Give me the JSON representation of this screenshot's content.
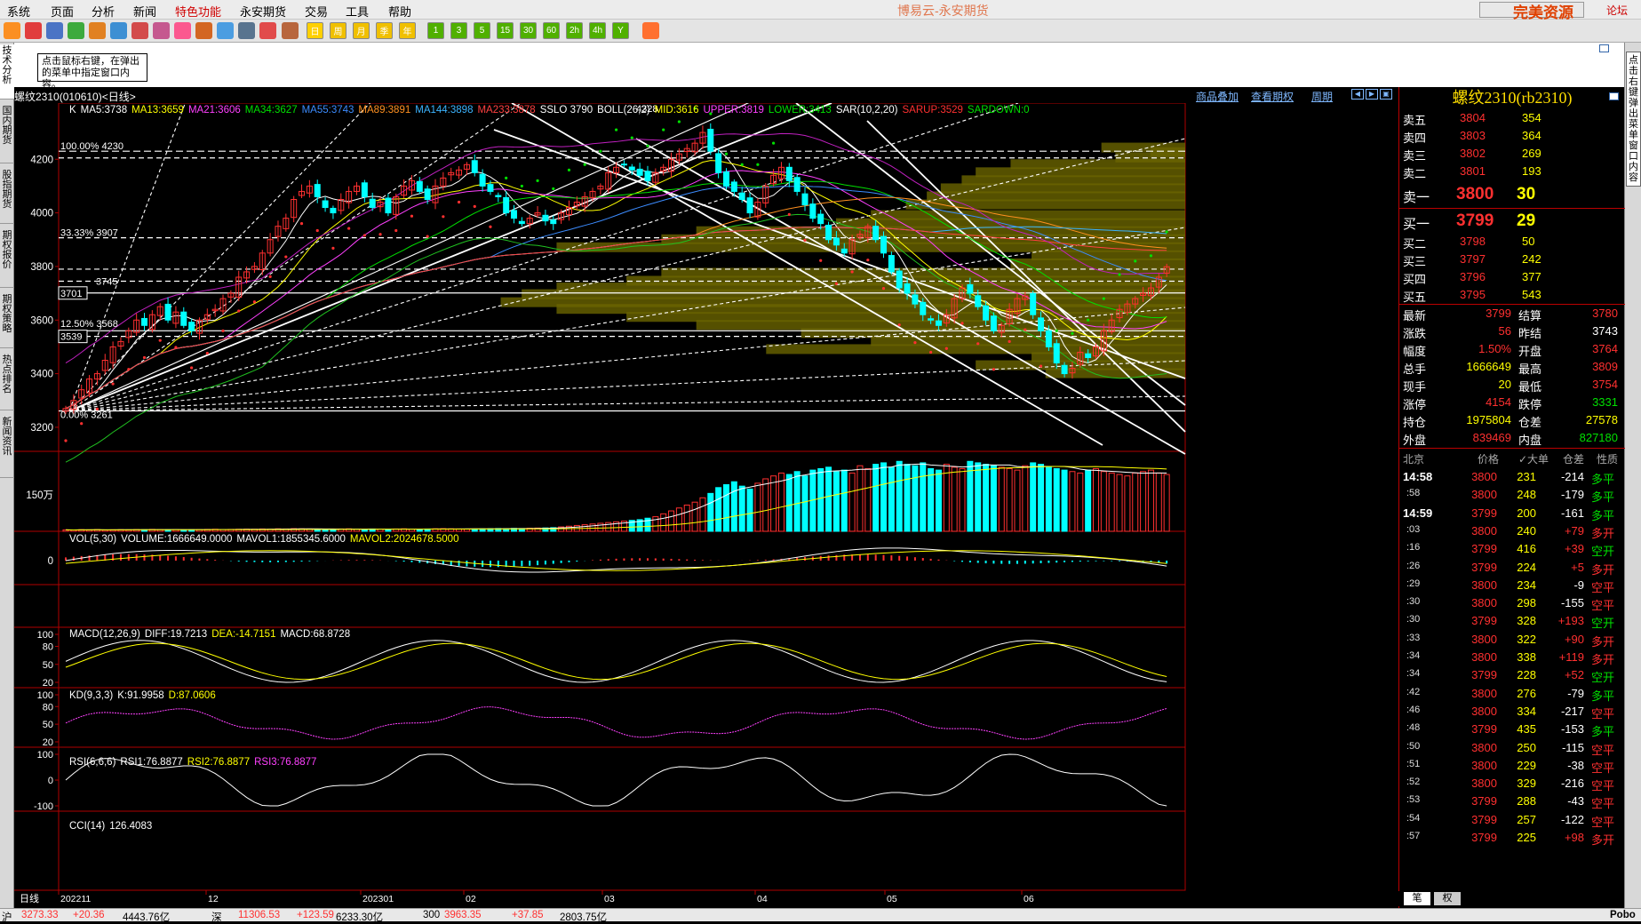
{
  "app": {
    "title": "博易云-永安期货"
  },
  "menu": [
    "系统",
    "页面",
    "分析",
    "新闻",
    "特色功能",
    "永安期货",
    "交易",
    "工具",
    "帮助"
  ],
  "window_controls": [
    "论坛",
    "—",
    "□",
    "×"
  ],
  "watermark": "完美资源 5etz.com",
  "toolbar_icons": [
    "back-icon",
    "home-icon",
    "quote-icon",
    "realtime-icon",
    "search-icon",
    "indicator-icon",
    "grid-icon",
    "pen-icon",
    "brush-icon",
    "cut-icon",
    "branch-icon",
    "table-icon",
    "kline-icon",
    "f10-icon",
    "day-icon",
    "week-icon",
    "month-icon",
    "quarter-icon",
    "year-icon",
    "m1-icon",
    "m3-icon",
    "m5-icon",
    "m15-icon",
    "m30-icon",
    "m60-icon",
    "m2h-icon",
    "m4h-icon",
    "y-icon",
    "calc-icon"
  ],
  "toolbar_labels": [
    "日",
    "周",
    "月",
    "季",
    "年",
    "1",
    "3",
    "5",
    "15",
    "30",
    "60",
    "2h",
    "4h",
    "Y"
  ],
  "left_tabs": [
    "技术分析",
    "国内期货",
    "股指期货",
    "期权报价",
    "期权策略",
    "热点排名",
    "新闻资讯"
  ],
  "right_tab": "点击右键弹出菜单窗口内容",
  "note": "点击鼠标右键，在弹出的菜单中指定窗口内容。",
  "chart_header": {
    "symbol": "螺纹2310(010610)<日线>",
    "links": [
      "商品叠加",
      "查看期权",
      "周期"
    ]
  },
  "legend_main": [
    {
      "t": "K",
      "c": "#ffffff"
    },
    {
      "t": "MA5:3738",
      "c": "#ffffff"
    },
    {
      "t": "MA13:3659",
      "c": "#ffff00"
    },
    {
      "t": "MA21:3606",
      "c": "#ff40ff"
    },
    {
      "t": "MA34:3627",
      "c": "#00e000"
    },
    {
      "t": "MA55:3743",
      "c": "#3c8cff"
    },
    {
      "t": "MA89:3891",
      "c": "#ff9020"
    },
    {
      "t": "MA144:3898",
      "c": "#3cb4ff"
    },
    {
      "t": "MA233:3878",
      "c": "#ff4040"
    },
    {
      "t": "SSLO 3790",
      "c": "#ffffff"
    },
    {
      "t": "BOLL(26,2)",
      "c": "#ffffff"
    },
    {
      "t": "MID:3616",
      "c": "#ffff00"
    },
    {
      "t": "UPPER:3819",
      "c": "#ff40ff"
    },
    {
      "t": "LOWER:3413",
      "c": "#00e000"
    },
    {
      "t": "SAR(10,2,20)",
      "c": "#ffffff"
    },
    {
      "t": "SARUP:3529",
      "c": "#ff3030"
    },
    {
      "t": "SARDOWN:0",
      "c": "#00e000"
    }
  ],
  "legend_vol": [
    {
      "t": "VOL(5,30)",
      "c": "#ffffff"
    },
    {
      "t": "VOLUME:1666649.0000",
      "c": "#ffffff"
    },
    {
      "t": "MAVOL1:1855345.6000",
      "c": "#ffffff"
    },
    {
      "t": "MAVOL2:2024678.5000",
      "c": "#ffff00"
    }
  ],
  "legend_macd": [
    {
      "t": "MACD(12,26,9)",
      "c": "#ffffff"
    },
    {
      "t": "DIFF:19.7213",
      "c": "#ffffff"
    },
    {
      "t": "DEA:-14.7151",
      "c": "#ffff00"
    },
    {
      "t": "MACD:68.8728",
      "c": "#ffffff"
    }
  ],
  "legend_kd": [
    {
      "t": "KD(9,3,3)",
      "c": "#ffffff"
    },
    {
      "t": "K:91.9958",
      "c": "#ffffff"
    },
    {
      "t": "D:87.0606",
      "c": "#ffff00"
    }
  ],
  "legend_rsi": [
    {
      "t": "RSI(6,6,6)",
      "c": "#ffffff"
    },
    {
      "t": "RSI1:76.8877",
      "c": "#ffffff"
    },
    {
      "t": "RSI2:76.8877",
      "c": "#ffff00"
    },
    {
      "t": "RSI3:76.8877",
      "c": "#ff40ff"
    }
  ],
  "legend_cci": [
    {
      "t": "CCI(14)",
      "c": "#ffffff"
    },
    {
      "t": "126.4083",
      "c": "#ffffff"
    }
  ],
  "axis": {
    "price_ticks": [
      "4200",
      "4000",
      "3800",
      "3600",
      "3400",
      "3200"
    ],
    "vol_tick": "150万",
    "macd_tick": "0",
    "kd_ticks": [
      "100",
      "80",
      "50",
      "20"
    ],
    "rsi_ticks": [
      "100",
      "80",
      "50",
      "20"
    ],
    "cci_ticks": [
      "100",
      "0",
      "-100"
    ],
    "x_label_prefix": "日线",
    "x_ticks": [
      "202211",
      "12",
      "202301",
      "02",
      "03",
      "04",
      "05",
      "06"
    ]
  },
  "annotations": {
    "high_label": "4328",
    "fib_100": "100.00%  4230",
    "fib_3333": "33.33%  3907",
    "fib_1250": "12.50%  3568",
    "fib_0": "0.00%  3261",
    "box_3701": "3701",
    "fib_3745": "3745",
    "box_3539": "3539"
  },
  "quote": {
    "title": "螺纹2310(rb2310)",
    "asks": [
      {
        "label": "卖五",
        "price": "3804",
        "vol": "354"
      },
      {
        "label": "卖四",
        "price": "3803",
        "vol": "364"
      },
      {
        "label": "卖三",
        "price": "3802",
        "vol": "269"
      },
      {
        "label": "卖二",
        "price": "3801",
        "vol": "193"
      }
    ],
    "ask1": {
      "label": "卖一",
      "price": "3800",
      "vol": "30"
    },
    "bid1": {
      "label": "买一",
      "price": "3799",
      "vol": "29"
    },
    "bids": [
      {
        "label": "买二",
        "price": "3798",
        "vol": "50"
      },
      {
        "label": "买三",
        "price": "3797",
        "vol": "242"
      },
      {
        "label": "买四",
        "price": "3796",
        "vol": "377"
      },
      {
        "label": "买五",
        "price": "3795",
        "vol": "543"
      }
    ],
    "stats": [
      {
        "l1": "最新",
        "v1": "3799",
        "c1": "#ff3030",
        "l2": "结算",
        "v2": "3780",
        "c2": "#ff3030"
      },
      {
        "l1": "涨跌",
        "v1": "56",
        "c1": "#ff3030",
        "l2": "昨结",
        "v2": "3743",
        "c2": "#ffffff"
      },
      {
        "l1": "幅度",
        "v1": "1.50%",
        "c1": "#ff3030",
        "l2": "开盘",
        "v2": "3764",
        "c2": "#ff3030"
      },
      {
        "l1": "总手",
        "v1": "1666649",
        "c1": "#ffff00",
        "l2": "最高",
        "v2": "3809",
        "c2": "#ff3030"
      },
      {
        "l1": "现手",
        "v1": "20",
        "c1": "#ffff00",
        "l2": "最低",
        "v2": "3754",
        "c2": "#ff3030"
      },
      {
        "l1": "涨停",
        "v1": "4154",
        "c1": "#ff3030",
        "l2": "跌停",
        "v2": "3331",
        "c2": "#00e000"
      },
      {
        "l1": "持仓",
        "v1": "1975804",
        "c1": "#ffff00",
        "l2": "仓差",
        "v2": "27578",
        "c2": "#ffff00"
      },
      {
        "l1": "外盘",
        "v1": "839469",
        "c1": "#ff3030",
        "l2": "内盘",
        "v2": "827180",
        "c2": "#00e000"
      }
    ],
    "tick_header": [
      "北京",
      "价格",
      "✓大单",
      "仓差",
      "性质"
    ],
    "ticks": [
      {
        "t": "14:58",
        "p": "3800",
        "pc": "#ff3030",
        "v": "231",
        "d": "-214",
        "n": "多平",
        "nc": "#00e000"
      },
      {
        "t": ":58",
        "p": "3800",
        "pc": "#ff3030",
        "v": "248",
        "d": "-179",
        "n": "多平",
        "nc": "#00e000"
      },
      {
        "t": "14:59",
        "p": "3799",
        "pc": "#ff3030",
        "v": "200",
        "d": "-161",
        "n": "多平",
        "nc": "#00e000"
      },
      {
        "t": ":03",
        "p": "3800",
        "pc": "#ff3030",
        "v": "240",
        "d": "+79",
        "n": "多开",
        "nc": "#ff3030"
      },
      {
        "t": ":16",
        "p": "3799",
        "pc": "#ff3030",
        "v": "416",
        "d": "+39",
        "n": "空开",
        "nc": "#00e000"
      },
      {
        "t": ":26",
        "p": "3799",
        "pc": "#ff3030",
        "v": "224",
        "d": "+5",
        "n": "多开",
        "nc": "#ff3030"
      },
      {
        "t": ":29",
        "p": "3800",
        "pc": "#ff3030",
        "v": "234",
        "d": "-9",
        "n": "空平",
        "nc": "#ff3030"
      },
      {
        "t": ":30",
        "p": "3800",
        "pc": "#ff3030",
        "v": "298",
        "d": "-155",
        "n": "空平",
        "nc": "#ff3030"
      },
      {
        "t": ":30",
        "p": "3799",
        "pc": "#ff3030",
        "v": "328",
        "d": "+193",
        "n": "空开",
        "nc": "#00e000"
      },
      {
        "t": ":33",
        "p": "3800",
        "pc": "#ff3030",
        "v": "322",
        "d": "+90",
        "n": "多开",
        "nc": "#ff3030"
      },
      {
        "t": ":34",
        "p": "3800",
        "pc": "#ff3030",
        "v": "338",
        "d": "+119",
        "n": "多开",
        "nc": "#ff3030"
      },
      {
        "t": ":34",
        "p": "3799",
        "pc": "#ff3030",
        "v": "228",
        "d": "+52",
        "n": "空开",
        "nc": "#00e000"
      },
      {
        "t": ":42",
        "p": "3800",
        "pc": "#ff3030",
        "v": "276",
        "d": "-79",
        "n": "多平",
        "nc": "#00e000"
      },
      {
        "t": ":46",
        "p": "3800",
        "pc": "#ff3030",
        "v": "334",
        "d": "-217",
        "n": "空平",
        "nc": "#ff3030"
      },
      {
        "t": ":48",
        "p": "3799",
        "pc": "#ff3030",
        "v": "435",
        "d": "-153",
        "n": "多平",
        "nc": "#00e000"
      },
      {
        "t": ":50",
        "p": "3800",
        "pc": "#ff3030",
        "v": "250",
        "d": "-115",
        "n": "空平",
        "nc": "#ff3030"
      },
      {
        "t": ":51",
        "p": "3800",
        "pc": "#ff3030",
        "v": "229",
        "d": "-38",
        "n": "空平",
        "nc": "#ff3030"
      },
      {
        "t": ":52",
        "p": "3800",
        "pc": "#ff3030",
        "v": "329",
        "d": "-216",
        "n": "空平",
        "nc": "#ff3030"
      },
      {
        "t": ":53",
        "p": "3799",
        "pc": "#ff3030",
        "v": "288",
        "d": "-43",
        "n": "空平",
        "nc": "#ff3030"
      },
      {
        "t": ":54",
        "p": "3799",
        "pc": "#ff3030",
        "v": "257",
        "d": "-122",
        "n": "空平",
        "nc": "#ff3030"
      },
      {
        "t": ":57",
        "p": "3799",
        "pc": "#ff3030",
        "v": "225",
        "d": "+98",
        "n": "多开",
        "nc": "#ff3030"
      }
    ],
    "bottom_tabs": [
      "笔",
      "权"
    ]
  },
  "status_bar": [
    {
      "label": "沪",
      "value": "3273.33",
      "vc": "#ff3030",
      "chg": "+20.36",
      "cc": "#ff3030",
      "amt": "4443.76亿"
    },
    {
      "label": "深",
      "value": "11306.53",
      "vc": "#ff3030",
      "chg": "+123.59",
      "cc": "#ff3030",
      "amt": "6233.30亿"
    },
    {
      "label": "300",
      "value": "3963.35",
      "vc": "#ff3030",
      "chg": "+37.85",
      "cc": "#ff3030",
      "amt": "2803.75亿"
    }
  ],
  "status_right": "Pobo",
  "chart_data": {
    "type": "candlestick",
    "title": "螺纹2310(010610)<日线>",
    "ylim": [
      3150,
      4350
    ],
    "price_ticks": [
      3200,
      3400,
      3600,
      3800,
      4000,
      4200
    ],
    "x_ticks": [
      "202211",
      "12",
      "202301",
      "02",
      "03",
      "04",
      "05",
      "06"
    ],
    "close_path": [
      3270,
      3300,
      3340,
      3380,
      3400,
      3450,
      3500,
      3520,
      3560,
      3600,
      3580,
      3620,
      3650,
      3600,
      3630,
      3580,
      3560,
      3600,
      3620,
      3640,
      3680,
      3700,
      3760,
      3780,
      3800,
      3850,
      3900,
      3950,
      3980,
      4050,
      4080,
      4100,
      4060,
      4020,
      4000,
      4050,
      4080,
      4100,
      4060,
      4020,
      4040,
      4000,
      4060,
      4100,
      4120,
      4080,
      4050,
      4100,
      4130,
      4150,
      4160,
      4180,
      4150,
      4100,
      4080,
      4060,
      4000,
      3980,
      3960,
      3980,
      4000,
      3970,
      3960,
      4000,
      4020,
      4040,
      4060,
      4080,
      4100,
      4150,
      4170,
      4180,
      4160,
      4140,
      4120,
      4150,
      4170,
      4200,
      4220,
      4240,
      4260,
      4300,
      4230,
      4150,
      4100,
      4080,
      4050,
      4000,
      4040,
      4100,
      4140,
      4170,
      4120,
      4080,
      4030,
      3980,
      3960,
      3900,
      3880,
      3850,
      3900,
      3920,
      3950,
      3900,
      3850,
      3780,
      3720,
      3700,
      3660,
      3620,
      3600,
      3580,
      3620,
      3680,
      3720,
      3700,
      3650,
      3600,
      3560,
      3580,
      3640,
      3680,
      3690,
      3620,
      3560,
      3500,
      3440,
      3400,
      3420,
      3480,
      3460,
      3500,
      3560,
      3600,
      3640,
      3660,
      3680,
      3700,
      3720,
      3760,
      3799
    ],
    "vol_path": [
      10,
      9,
      11,
      10,
      12,
      9,
      10,
      11,
      10,
      12,
      11,
      13,
      12,
      11,
      12,
      10,
      11,
      12,
      13,
      14,
      12,
      13,
      14,
      15,
      14,
      16,
      15,
      17,
      16,
      18,
      17,
      16,
      15,
      14,
      15,
      16,
      17,
      15,
      14,
      16,
      15,
      14,
      16,
      17,
      15,
      14,
      16,
      17,
      18,
      17,
      16,
      15,
      16,
      17,
      18,
      19,
      18,
      20,
      19,
      21,
      22,
      23,
      25,
      30,
      35,
      40,
      45,
      50,
      55,
      60,
      65,
      70,
      75,
      80,
      90,
      100,
      120,
      140,
      160,
      180,
      200,
      230,
      260,
      300,
      320,
      340,
      310,
      290,
      330,
      360,
      380,
      400,
      390,
      410,
      380,
      420,
      430,
      440,
      410,
      420,
      400,
      450,
      430,
      460,
      470,
      440,
      480,
      460,
      450,
      470,
      430,
      420,
      460,
      440,
      430,
      480,
      470,
      460,
      450,
      440,
      430,
      420,
      450,
      470,
      460,
      440,
      430,
      420,
      410,
      400,
      420,
      430,
      410,
      400,
      390,
      380,
      400,
      410,
      420,
      400,
      390
    ]
  }
}
